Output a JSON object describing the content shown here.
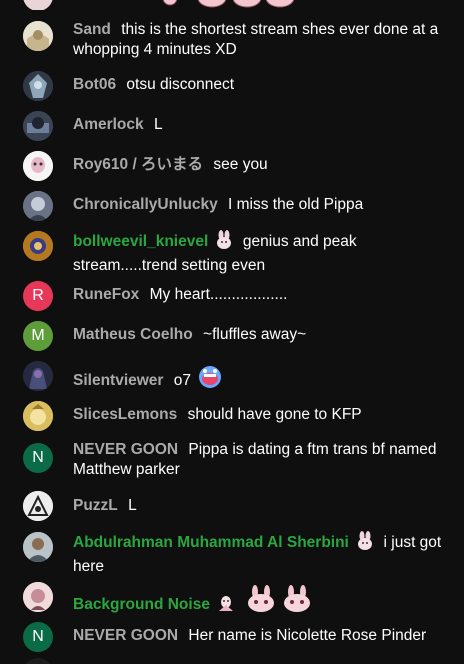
{
  "colors": {
    "background": "#0f0f0f",
    "author": "#aaaaaa",
    "member_author": "#2ba640",
    "message": "#ffffff"
  },
  "messages": [
    {
      "author": "Sand",
      "text": "this is the shortest stream shes ever done at a whopping 4 minutes XD",
      "avatar": "image"
    },
    {
      "author": "Bot06",
      "text": "otsu disconnect",
      "avatar": "image"
    },
    {
      "author": "Amerlock",
      "text": "L",
      "avatar": "image"
    },
    {
      "author": "Roy610 / ろいまる",
      "text": "see you",
      "avatar": "image"
    },
    {
      "author": "ChronicallyUnlucky",
      "text": "I miss the old Pippa",
      "avatar": "image"
    },
    {
      "author": "bollweevil_knievel",
      "text": "genius and peak stream.....trend setting even",
      "member": true,
      "avatar": "image"
    },
    {
      "author": "RuneFox",
      "text": "My heart..................",
      "avatar_letter": "R",
      "avatar_color": "#e8385a"
    },
    {
      "author": "Matheus Coelho",
      "text": "~fluffles away~",
      "avatar_letter": "M",
      "avatar_color": "#5e9e3a"
    },
    {
      "author": "Silentviewer",
      "text": "o7",
      "avatar": "image"
    },
    {
      "author": "SlicesLemons",
      "text": "should have gone to KFP",
      "avatar": "image"
    },
    {
      "author": "NEVER GOON",
      "text": "Pippa is dating a ftm trans bf named Matthew parker",
      "avatar_letter": "N",
      "avatar_color": "#0b6b47"
    },
    {
      "author": "PuzzL",
      "text": "L",
      "avatar": "image"
    },
    {
      "author": "Abdulrahman Muhammad Al Sherbini",
      "text": "i just got here",
      "member": true,
      "avatar": "image"
    },
    {
      "author": "Background Noise",
      "text": "",
      "member": true,
      "avatar": "image"
    },
    {
      "author": "NEVER GOON",
      "text": "Her name is Nicolette Rose Pinder",
      "avatar_letter": "N",
      "avatar_color": "#0b6b47"
    }
  ]
}
